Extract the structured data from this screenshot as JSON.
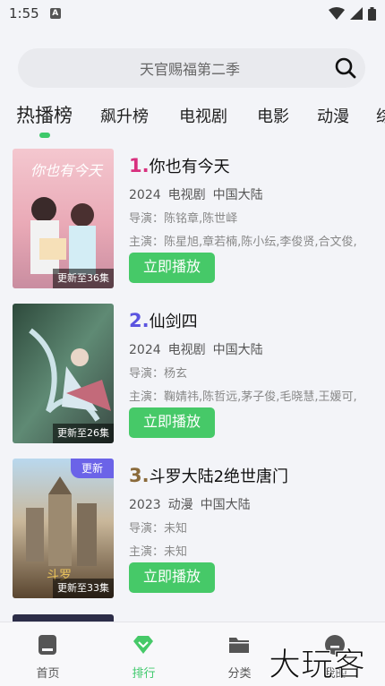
{
  "status_bar": {
    "time": "1:55",
    "notification_letter": "A"
  },
  "search": {
    "placeholder": "天官赐福第二季"
  },
  "tabs": [
    {
      "label": "热播榜",
      "active": true
    },
    {
      "label": "飙升榜",
      "active": false
    },
    {
      "label": "电视剧",
      "active": false
    },
    {
      "label": "电影",
      "active": false
    },
    {
      "label": "动漫",
      "active": false
    },
    {
      "label": "综",
      "active": false
    }
  ],
  "items": [
    {
      "rank": "1.",
      "rank_color": "#d8307e",
      "title": "你也有今天",
      "year": "2024",
      "type": "电视剧",
      "region": "中国大陆",
      "director": "导演：陈铭章,陈世峄",
      "cast": "主演：陈星旭,章若楠,陈小纭,李俊贤,合文俊,",
      "update": "更新至36集",
      "badge": "",
      "button": "立即播放"
    },
    {
      "rank": "2.",
      "rank_color": "#5b54e0",
      "title": "仙剑四",
      "year": "2024",
      "type": "电视剧",
      "region": "中国大陆",
      "director": "导演：杨玄",
      "cast": "主演：鞠婧祎,陈哲远,茅子俊,毛晓慧,王媛可,",
      "update": "更新至26集",
      "badge": "",
      "button": "立即播放"
    },
    {
      "rank": "3.",
      "rank_color": "#8a6a3a",
      "title": "斗罗大陆2绝世唐门",
      "year": "2023",
      "type": "动漫",
      "region": "中国大陆",
      "director": "导演：未知",
      "cast": "主演：未知",
      "update": "更新至33集",
      "badge": "更新",
      "button": "立即播放"
    }
  ],
  "bottom_nav": [
    {
      "label": "首页",
      "icon": "home-icon",
      "active": false
    },
    {
      "label": "排行",
      "icon": "ranking-diamond-icon",
      "active": true
    },
    {
      "label": "分类",
      "icon": "folder-icon",
      "active": false
    },
    {
      "label": "我的",
      "icon": "profile-icon",
      "active": false
    }
  ],
  "watermark": "大玩客",
  "colors": {
    "accent": "#46c968",
    "badge_purple": "#6b63e8"
  }
}
